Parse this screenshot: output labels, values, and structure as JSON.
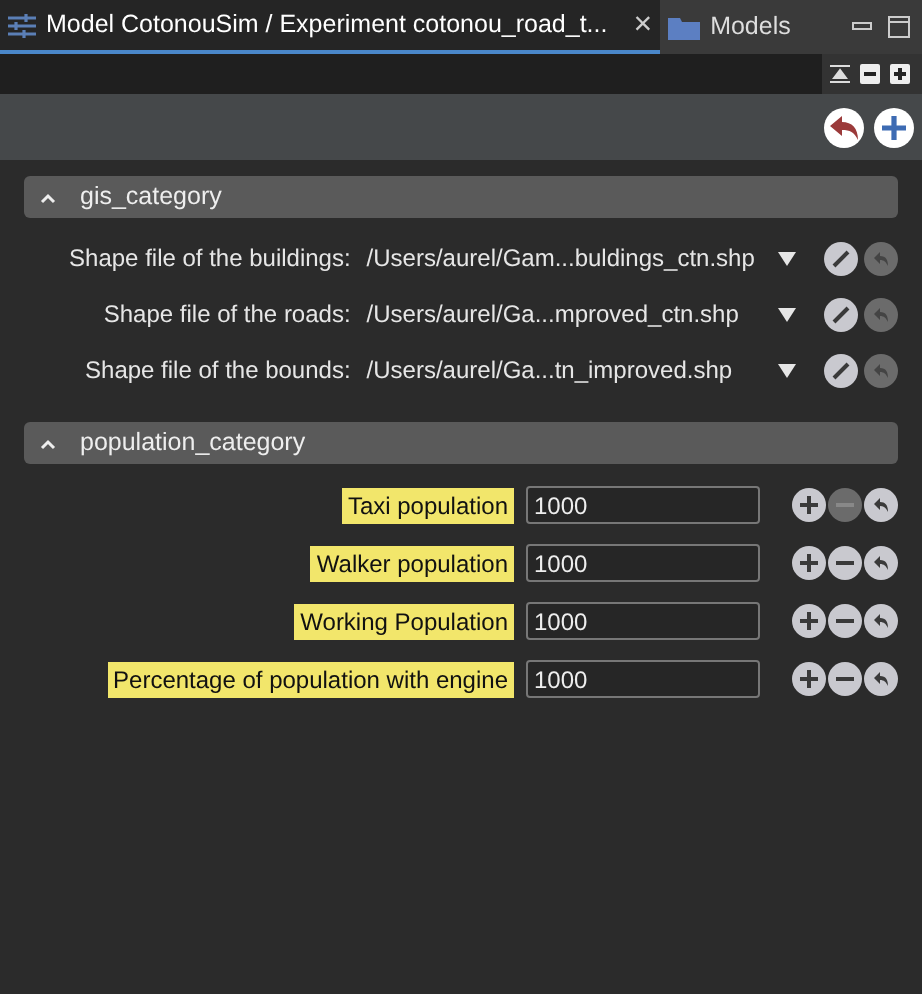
{
  "tabs": [
    {
      "label": "Model CotonouSim / Experiment cotonou_road_t...",
      "selected": true,
      "close": "×"
    },
    {
      "label": "Models",
      "selected": false
    }
  ],
  "categories": [
    {
      "title": "gis_category",
      "expanded": true,
      "rows": [
        {
          "kind": "file",
          "label": "Shape file of the buildings:",
          "value": "/Users/aurel/Gam...buldings_ctn.shp",
          "revert_disabled": true
        },
        {
          "kind": "file",
          "label": "Shape file of the roads:",
          "value": "/Users/aurel/Ga...mproved_ctn.shp",
          "revert_disabled": true
        },
        {
          "kind": "file",
          "label": "Shape file of the bounds:",
          "value": "/Users/aurel/Ga...tn_improved.shp",
          "revert_disabled": true
        }
      ]
    },
    {
      "title": "population_category",
      "expanded": true,
      "rows": [
        {
          "kind": "number",
          "label": "Taxi population",
          "value": "1000",
          "minus_disabled": true
        },
        {
          "kind": "number",
          "label": "Walker population",
          "value": "1000",
          "minus_disabled": false
        },
        {
          "kind": "number",
          "label": "Working Population",
          "value": "1000",
          "minus_disabled": false
        },
        {
          "kind": "number",
          "label": "Percentage of population with engine",
          "value": "1000",
          "minus_disabled": false
        }
      ]
    }
  ]
}
